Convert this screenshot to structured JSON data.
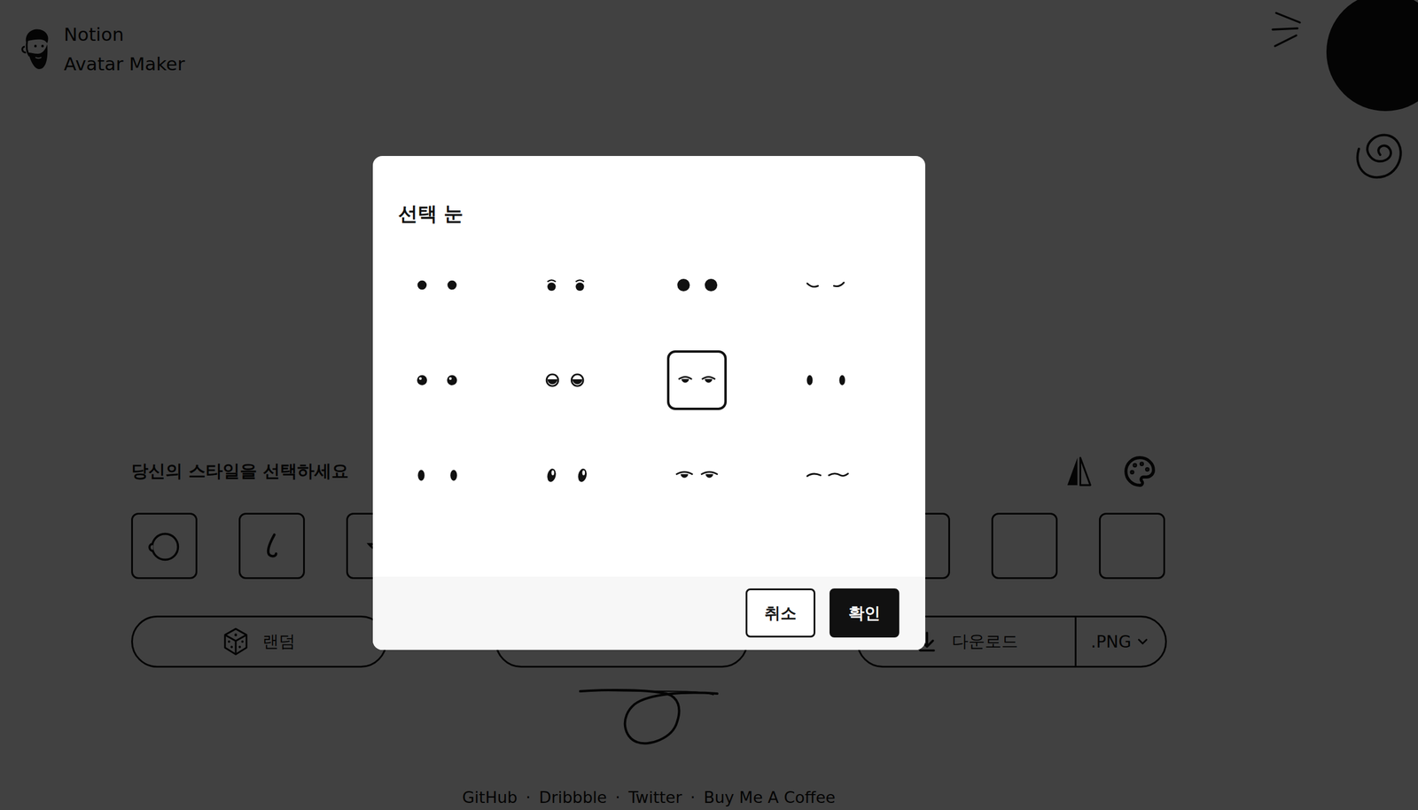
{
  "app": {
    "title_line1": "Notion",
    "title_line2": "Avatar Maker"
  },
  "style_picker": {
    "label": "당신의 스타일을 선택하세요",
    "tiles": [
      {
        "kind": "face"
      },
      {
        "kind": "nose"
      },
      {
        "kind": "mouth"
      },
      {
        "kind": "blank"
      },
      {
        "kind": "blank"
      },
      {
        "kind": "blank"
      },
      {
        "kind": "blank"
      },
      {
        "kind": "blank"
      },
      {
        "kind": "blank"
      },
      {
        "kind": "blank"
      }
    ]
  },
  "actions": {
    "random": "랜덤",
    "download": "다운로드",
    "format": ".PNG"
  },
  "footer": {
    "links": [
      "GitHub",
      "Dribbble",
      "Twitter",
      "Buy Me A Coffee"
    ],
    "separator": "·"
  },
  "dialog": {
    "title": "선택 눈",
    "options": [
      {
        "kind": "dots",
        "selected": false
      },
      {
        "kind": "brow-dots",
        "selected": false
      },
      {
        "kind": "big-dots",
        "selected": false
      },
      {
        "kind": "closed",
        "selected": false
      },
      {
        "kind": "glint-dots",
        "selected": false
      },
      {
        "kind": "rimmed",
        "selected": false
      },
      {
        "kind": "lidded",
        "selected": true
      },
      {
        "kind": "ovals",
        "selected": false
      },
      {
        "kind": "small-ovals",
        "selected": false
      },
      {
        "kind": "tilted",
        "selected": false
      },
      {
        "kind": "lidded-wide",
        "selected": false
      },
      {
        "kind": "flat",
        "selected": false
      }
    ],
    "buttons": [
      {
        "label": "취소",
        "kind": "secondary"
      },
      {
        "label": "확인",
        "kind": "primary"
      }
    ]
  }
}
